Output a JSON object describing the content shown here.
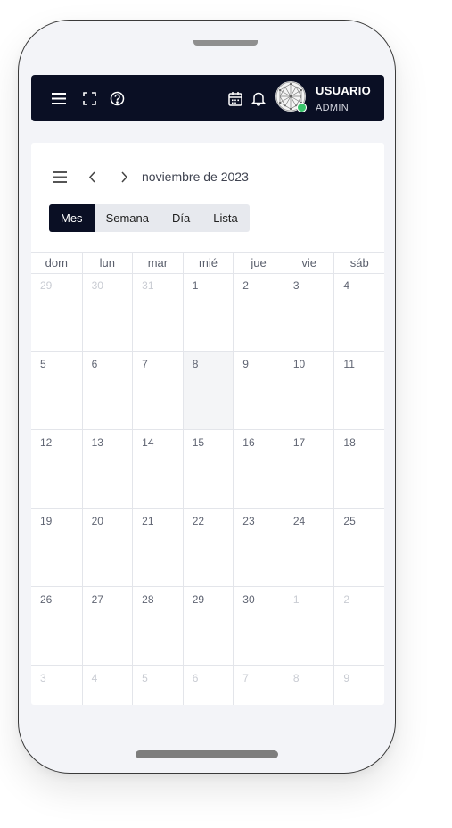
{
  "header": {
    "user_name": "USUARIO",
    "user_role": "ADMIN",
    "icons": [
      "menu-icon",
      "fullscreen-icon",
      "help-icon",
      "calendar-icon",
      "bell-icon"
    ],
    "status_color": "#39c46b",
    "bar_color": "#0a0f24"
  },
  "calendar": {
    "title": "noviembre de 2023",
    "views": [
      {
        "label": "Mes",
        "active": true
      },
      {
        "label": "Semana",
        "active": false
      },
      {
        "label": "Día",
        "active": false
      },
      {
        "label": "Lista",
        "active": false
      }
    ],
    "weekdays": [
      "dom",
      "lun",
      "mar",
      "mié",
      "jue",
      "vie",
      "sáb"
    ],
    "weeks": [
      [
        {
          "d": "29",
          "o": true
        },
        {
          "d": "30",
          "o": true
        },
        {
          "d": "31",
          "o": true
        },
        {
          "d": "1"
        },
        {
          "d": "2"
        },
        {
          "d": "3"
        },
        {
          "d": "4"
        }
      ],
      [
        {
          "d": "5"
        },
        {
          "d": "6"
        },
        {
          "d": "7"
        },
        {
          "d": "8",
          "today": true
        },
        {
          "d": "9"
        },
        {
          "d": "10"
        },
        {
          "d": "11"
        }
      ],
      [
        {
          "d": "12"
        },
        {
          "d": "13"
        },
        {
          "d": "14"
        },
        {
          "d": "15"
        },
        {
          "d": "16"
        },
        {
          "d": "17"
        },
        {
          "d": "18"
        }
      ],
      [
        {
          "d": "19"
        },
        {
          "d": "20"
        },
        {
          "d": "21"
        },
        {
          "d": "22"
        },
        {
          "d": "23"
        },
        {
          "d": "24"
        },
        {
          "d": "25"
        }
      ],
      [
        {
          "d": "26"
        },
        {
          "d": "27"
        },
        {
          "d": "28"
        },
        {
          "d": "29"
        },
        {
          "d": "30"
        },
        {
          "d": "1",
          "o": true
        },
        {
          "d": "2",
          "o": true
        }
      ],
      [
        {
          "d": "3",
          "o": true
        },
        {
          "d": "4",
          "o": true
        },
        {
          "d": "5",
          "o": true
        },
        {
          "d": "6",
          "o": true
        },
        {
          "d": "7",
          "o": true
        },
        {
          "d": "8",
          "o": true
        },
        {
          "d": "9",
          "o": true
        }
      ]
    ]
  }
}
